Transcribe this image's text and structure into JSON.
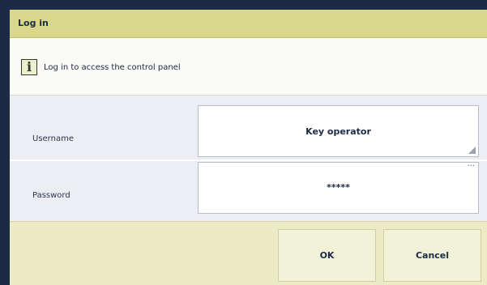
{
  "dialog": {
    "title": "Log in"
  },
  "info": {
    "icon": "info-icon",
    "icon_glyph": "i",
    "message": "Log in to access the control panel"
  },
  "form": {
    "username": {
      "label": "Username",
      "value": "Key operator"
    },
    "password": {
      "label": "Password",
      "value": "*****",
      "more_glyph": "..."
    }
  },
  "buttons": {
    "ok_label": "OK",
    "cancel_label": "Cancel"
  },
  "colors": {
    "titlebar": "#d9d88a",
    "footer": "#ebebc6",
    "button": "#f1f2d7",
    "text": "#1c2a44",
    "frame": "#1c2a44"
  }
}
